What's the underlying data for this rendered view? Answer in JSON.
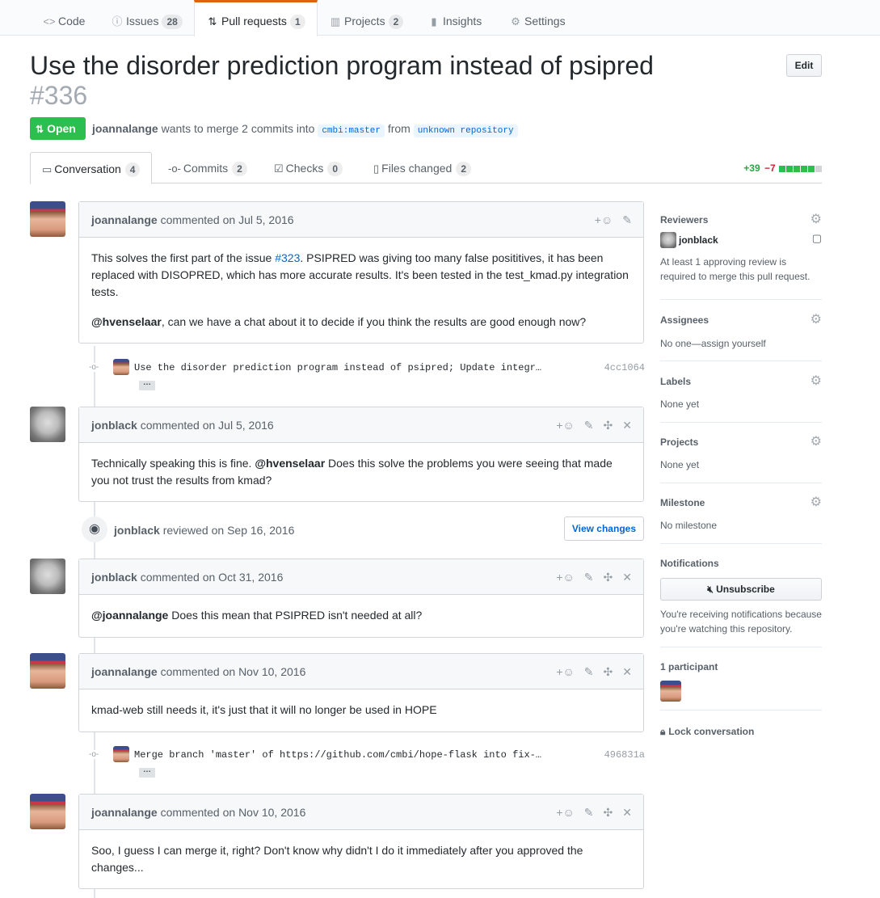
{
  "repo_nav": {
    "tabs": [
      {
        "label": "Code",
        "icon": "code-icon",
        "count": ""
      },
      {
        "label": "Issues",
        "icon": "issue-icon",
        "count": "28"
      },
      {
        "label": "Pull requests",
        "icon": "pull-request-icon",
        "count": "1"
      },
      {
        "label": "Projects",
        "icon": "project-icon",
        "count": "2"
      },
      {
        "label": "Insights",
        "icon": "graph-icon",
        "count": ""
      },
      {
        "label": "Settings",
        "icon": "gear-icon",
        "count": ""
      }
    ]
  },
  "header": {
    "title": "Use the disorder prediction program instead of psipred",
    "number": "#336",
    "edit_label": "Edit",
    "state": "Open",
    "author": "joannalange",
    "action": "wants to merge 2 commits into",
    "base_branch": "cmbi:master",
    "from_text": "from",
    "head_branch": "unknown repository"
  },
  "pr_tabs": [
    {
      "label": "Conversation",
      "count": "4"
    },
    {
      "label": "Commits",
      "count": "2"
    },
    {
      "label": "Checks",
      "count": "0"
    },
    {
      "label": "Files changed",
      "count": "2"
    }
  ],
  "diffstat": {
    "additions": "+39",
    "deletions": "−7",
    "colors": [
      "#2cbe4e",
      "#2cbe4e",
      "#2cbe4e",
      "#2cbe4e",
      "#2cbe4e",
      "#d1d5da"
    ]
  },
  "timeline": {
    "comment1": {
      "author": "joannalange",
      "meta": "commented on Jul 5, 2016",
      "p1_before": "This solves the first part of the issue ",
      "p1_link": "#323",
      "p1_after": ". PSIPRED was giving too many false posititives, it has been replaced with DISOPRED, which has more accurate results. It's been tested in the test_kmad.py integration tests.",
      "p2_mention": "@hvenselaar",
      "p2_text": ", can we have a chat about it to decide if you think the results are good enough now?"
    },
    "commit1": {
      "message": "Use the disorder prediction program instead of psipred; Update integr…",
      "sha": "4cc1064",
      "ellipsis": "…"
    },
    "comment2": {
      "author": "jonblack",
      "meta": "commented on Jul 5, 2016",
      "before": "Technically speaking this is fine. ",
      "mention": "@hvenselaar",
      "after": " Does this solve the problems you were seeing that made you not trust the results from kmad?"
    },
    "review": {
      "author": "jonblack",
      "meta": "reviewed on Sep 16, 2016",
      "button": "View changes"
    },
    "comment3": {
      "author": "jonblack",
      "meta": "commented on Oct 31, 2016",
      "mention": "@joannalange",
      "after": " Does this mean that PSIPRED isn't needed at all?"
    },
    "comment4": {
      "author": "joannalange",
      "meta": "commented on Nov 10, 2016",
      "text": "kmad-web still needs it, it's just that it will no longer be used in HOPE"
    },
    "commit2": {
      "message": "Merge branch 'master' of https://github.com/cmbi/hope-flask into fix-…",
      "sha": "496831a",
      "ellipsis": "…"
    },
    "comment5": {
      "author": "joannalange",
      "meta": "commented on Nov 10, 2016",
      "text": "Soo, I guess I can merge it, right? Don't know why didn't I do it immediately after you approved the changes..."
    }
  },
  "sidebar": {
    "reviewers": {
      "heading": "Reviewers",
      "name": "jonblack",
      "note": "At least 1 approving review is required to merge this pull request."
    },
    "assignees": {
      "heading": "Assignees",
      "value": "No one—assign yourself"
    },
    "labels": {
      "heading": "Labels",
      "value": "None yet"
    },
    "projects": {
      "heading": "Projects",
      "value": "None yet"
    },
    "milestone": {
      "heading": "Milestone",
      "value": "No milestone"
    },
    "notifications": {
      "heading": "Notifications",
      "button": "Unsubscribe",
      "note": "You're receiving notifications because you're watching this repository."
    },
    "participants": {
      "heading": "1 participant"
    },
    "lock": "Lock conversation"
  }
}
